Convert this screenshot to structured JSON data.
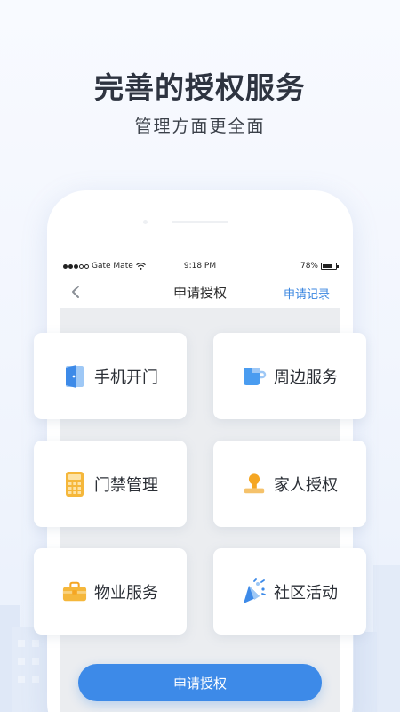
{
  "promo": {
    "title": "完善的授权服务",
    "subtitle": "管理方面更全面"
  },
  "status_bar": {
    "carrier": "Gate Mate",
    "time": "9:18 PM",
    "battery_percent": "78%",
    "battery_level": 0.78
  },
  "navbar": {
    "title": "申请授权",
    "action": "申请记录"
  },
  "services": [
    {
      "label": "手机开门",
      "icon": "door-icon",
      "color": "#3d8ae8"
    },
    {
      "label": "周边服务",
      "icon": "cup-icon",
      "color": "#4a9cf0"
    },
    {
      "label": "门禁管理",
      "icon": "keypad-icon",
      "color": "#f5b73b"
    },
    {
      "label": "家人授权",
      "icon": "stamp-icon",
      "color": "#f5a623"
    },
    {
      "label": "物业服务",
      "icon": "toolbox-icon",
      "color": "#f5b73b"
    },
    {
      "label": "社区活动",
      "icon": "party-popper-icon",
      "color": "#3d8ae8"
    }
  ],
  "apply_button": {
    "label": "申请授权"
  }
}
